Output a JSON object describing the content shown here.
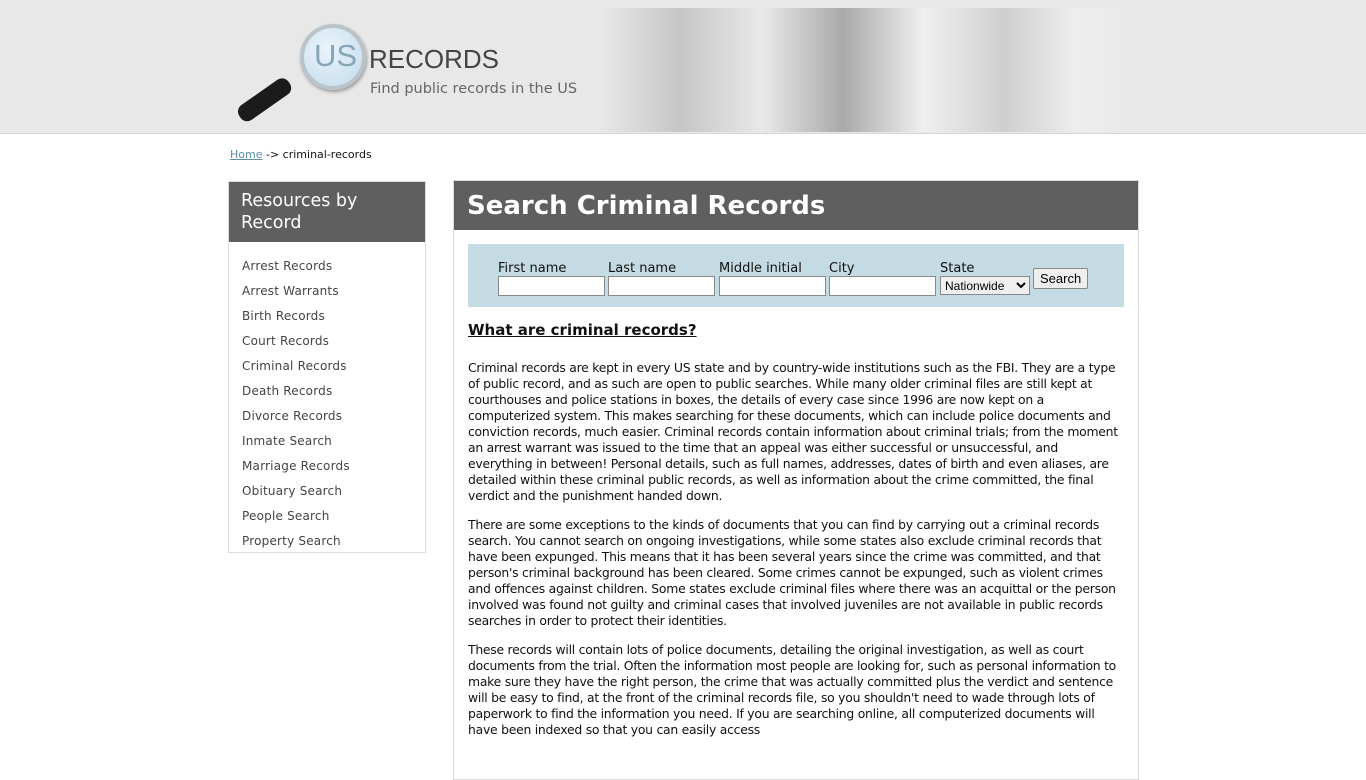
{
  "header": {
    "logo_us": "US",
    "logo_brand": "RECORDS",
    "tagline": "Find public records in the US"
  },
  "breadcrumb": {
    "home": "Home",
    "separator": "->",
    "current": "criminal-records"
  },
  "sidebar": {
    "title": "Resources by Record",
    "items": [
      "Arrest Records",
      "Arrest Warrants",
      "Birth Records",
      "Court Records",
      "Criminal Records",
      "Death Records",
      "Divorce Records",
      "Inmate Search",
      "Marriage Records",
      "Obituary Search",
      "People Search",
      "Property Search"
    ]
  },
  "main": {
    "title": "Search Criminal Records",
    "search": {
      "first_name": "First name",
      "last_name": "Last name",
      "middle_initial": "Middle initial",
      "city": "City",
      "state": "State",
      "state_value": "Nationwide",
      "button": "Search"
    },
    "heading": "What are criminal records?",
    "paragraphs": [
      "Criminal records are kept in every US state and by country-wide institutions such as the FBI. They are a type of public record, and as such are open to public searches. While many older criminal files are still kept at courthouses and police stations in boxes, the details of every case since 1996 are now kept on a computerized system. This makes searching for these documents, which can include police documents and conviction records, much easier. Criminal records contain information about criminal trials; from the moment an arrest warrant was issued to the time that an appeal was either successful or unsuccessful, and everything in between! Personal details, such as full names, addresses, dates of birth and even aliases, are detailed within these criminal public records, as well as information about the crime committed, the final verdict and the punishment handed down.",
      "There are some exceptions to the kinds of documents that you can find by carrying out a criminal records search. You cannot search on ongoing investigations, while some states also exclude criminal records that have been expunged. This means that it has been several years since the crime was committed, and that person's criminal background has been cleared. Some crimes cannot be expunged, such as violent crimes and offences against children. Some states exclude criminal files where there was an acquittal or the person involved was found not guilty and criminal cases that involved juveniles are not available in public records searches in order to protect their identities.",
      "These records will contain lots of police documents, detailing the original investigation, as well as court documents from the trial. Often the information most people are looking for, such as personal information to make sure they have the right person, the crime that was actually committed plus the verdict and sentence will be easy to find, at the front of the criminal records file, so you shouldn't need to wade through lots of paperwork to find the information you need. If you are searching online, all computerized documents will have been indexed so that you can easily access"
    ]
  }
}
